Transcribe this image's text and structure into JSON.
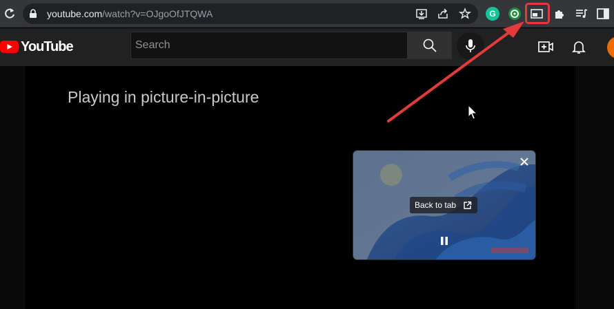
{
  "browser": {
    "url_host": "youtube.com",
    "url_path": "/watch?v=OJgoOfJTQWA",
    "icons": [
      "reload-icon",
      "lock-icon",
      "install-app-icon",
      "share-icon",
      "bookmark-star-icon",
      "grammarly-extension-icon",
      "green-extension-icon",
      "picture-in-picture-icon",
      "extensions-puzzle-icon",
      "media-queue-icon",
      "side-panel-icon"
    ],
    "grammarly_letter": "G"
  },
  "youtube": {
    "logo_text": "YouTube",
    "search_placeholder": "Search",
    "icons": [
      "search-icon",
      "mic-icon",
      "create-video-icon",
      "notifications-bell-icon"
    ]
  },
  "content": {
    "message": "Playing in picture-in-picture"
  },
  "pip": {
    "back_to_tab_label": "Back to tab",
    "icons": [
      "close-icon",
      "open-in-tab-icon",
      "pause-icon"
    ]
  },
  "colors": {
    "highlight": "#e33b3b",
    "yt_red": "#ff0000",
    "grammarly": "#15c39a",
    "avatar": "#ef6c00"
  }
}
